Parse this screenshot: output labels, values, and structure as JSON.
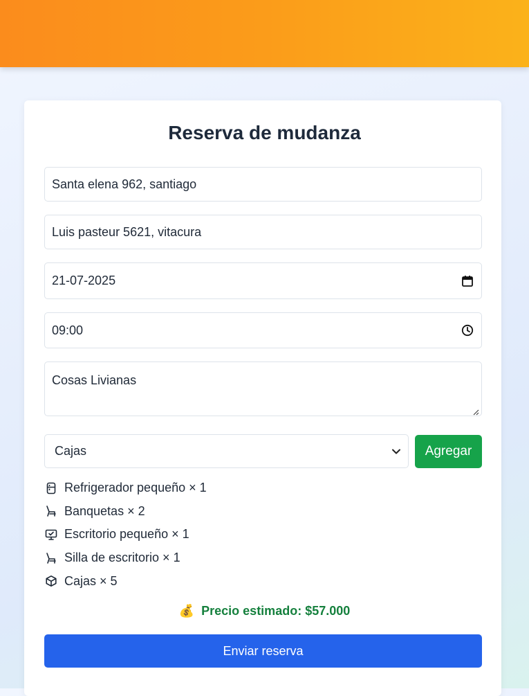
{
  "header": {
    "accent_color": "#fb9c1a"
  },
  "form": {
    "title": "Reserva de mudanza",
    "origin_address": "Santa elena 962, santiago",
    "destination_address": "Luis pasteur 5621, vitacura",
    "date": "21-07-2025",
    "time": "09:00",
    "notes": "Cosas Livianas",
    "item_select": {
      "selected": "Cajas",
      "icon": "chevron-down-icon"
    },
    "add_button_label": "Agregar",
    "add_button_color": "#16a34a",
    "items": [
      {
        "icon": "fridge-icon",
        "label": "Refrigerador pequeño × 1"
      },
      {
        "icon": "chair-icon",
        "label": "Banquetas × 2"
      },
      {
        "icon": "monitor-icon",
        "label": "Escritorio pequeño × 1"
      },
      {
        "icon": "chair-icon",
        "label": "Silla de escritorio × 1"
      },
      {
        "icon": "box-icon",
        "label": "Cajas × 5"
      }
    ],
    "price_emoji": "💰",
    "price_text": "Precio estimado: $57.000",
    "submit_label": "Enviar reserva",
    "submit_color": "#2563eb"
  }
}
